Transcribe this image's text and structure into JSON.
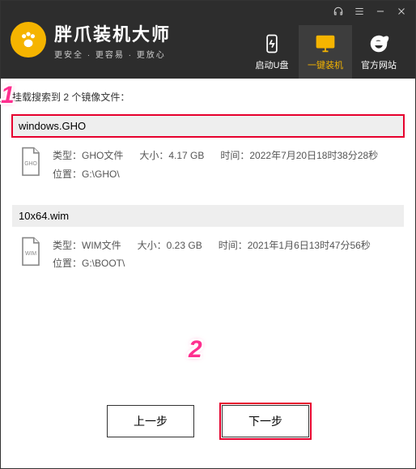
{
  "brand": {
    "title": "胖爪装机大师",
    "subtitle": "更安全 · 更容易 · 更放心"
  },
  "tabs": {
    "boot": "启动U盘",
    "reinstall": "一键装机",
    "site": "官方网站"
  },
  "search_line_prefix": "挂载搜索到 ",
  "search_count": "2",
  "search_line_suffix": " 个镜像文件：",
  "files": [
    {
      "name": "windows.GHO",
      "type_label": "类型：GHO文件",
      "size_label": "大小：4.17 GB",
      "time_label": "时间：2022年7月20日18时38分28秒",
      "loc_label": "位置：G:\\GHO\\",
      "badge": "GHO"
    },
    {
      "name": "10x64.wim",
      "type_label": "类型：WIM文件",
      "size_label": "大小：0.23 GB",
      "time_label": "时间：2021年1月6日13时47分56秒",
      "loc_label": "位置：G:\\BOOT\\",
      "badge": "WIM"
    }
  ],
  "buttons": {
    "prev": "上一步",
    "next": "下一步"
  },
  "annotations": {
    "one": "1",
    "two": "2"
  }
}
